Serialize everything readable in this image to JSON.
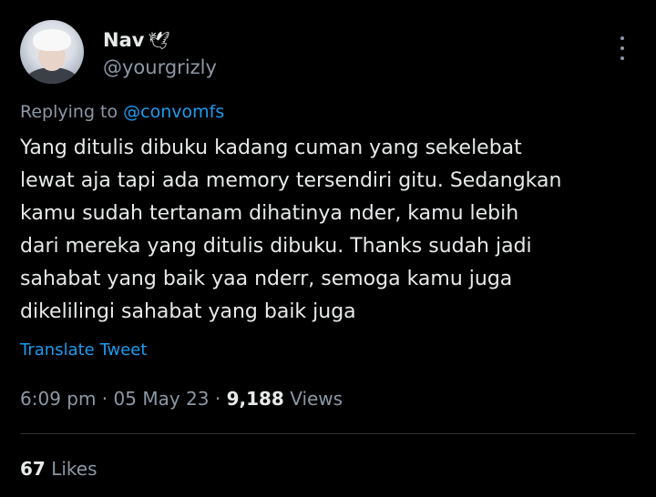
{
  "author": {
    "display_name": "Nav",
    "badge_emoji": "🕊",
    "handle": "@yourgrizly",
    "avatar_icon": "user-avatar"
  },
  "reply": {
    "prefix": "Replying to",
    "mention": "@convomfs"
  },
  "tweet": {
    "text": "Yang ditulis dibuku kadang cuman yang sekelebat\nlewat aja tapi ada memory tersendiri gitu. Sedangkan\nkamu sudah tertanam dihatinya nder, kamu lebih\ndari mereka yang ditulis dibuku. Thanks sudah jadi\nsahabat yang baik yaa nderr, semoga kamu juga\ndikelilingi sahabat yang baik juga"
  },
  "translate_label": "Translate Tweet",
  "meta": {
    "time": "6:09 pm",
    "separator": " · ",
    "date": "05 May 23",
    "views_count": "9,188",
    "views_label": "Views"
  },
  "engagement": {
    "likes_count": "67",
    "likes_label": "Likes"
  },
  "colors": {
    "background": "#000000",
    "text": "#e7e9ea",
    "secondary": "#8b98a5",
    "link": "#1d9bf0"
  }
}
